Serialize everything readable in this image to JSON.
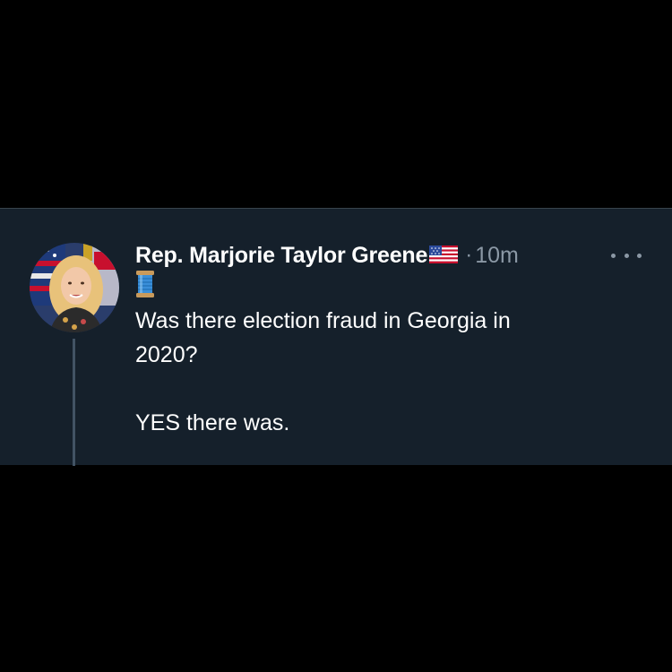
{
  "tweet": {
    "display_name": "Rep. Marjorie Taylor Greene",
    "name_emoji": "us-flag-icon",
    "separator": "·",
    "timestamp": "10m",
    "lead_emoji": "spool-of-thread-icon",
    "text_lines": [
      "Was there election fraud in Georgia in",
      "2020?",
      "",
      "YES there was."
    ]
  },
  "colors": {
    "page_background": "#000000",
    "card_background": "#15202b",
    "primary_text": "#ffffff",
    "secondary_text": "#8b98a5",
    "thread_line": "#425364"
  }
}
